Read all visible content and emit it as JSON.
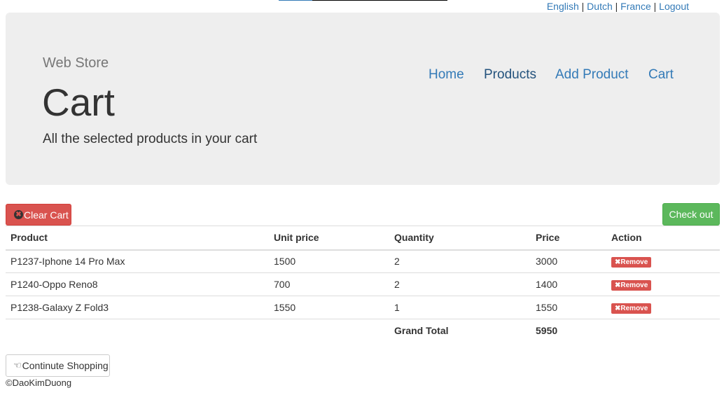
{
  "loading_bar": {
    "progress": 0.2
  },
  "language_bar": {
    "items": [
      "English",
      "Dutch",
      "France",
      "Logout"
    ],
    "separator": "|"
  },
  "header": {
    "brand": "Web Store",
    "title": "Cart",
    "subtitle": "All the selected products in your cart"
  },
  "nav": {
    "items": [
      {
        "label": "Home",
        "active": false
      },
      {
        "label": "Products",
        "active": true
      },
      {
        "label": "Add Product",
        "active": false
      },
      {
        "label": "Cart",
        "active": false
      }
    ]
  },
  "actions": {
    "clear_cart": "Clear Cart",
    "checkout": "Check out",
    "continue_shopping": "Continute Shopping"
  },
  "table": {
    "headers": [
      "Product",
      "Unit price",
      "Quantity",
      "Price",
      "Action"
    ],
    "rows": [
      {
        "product": "P1237-Iphone 14 Pro Max",
        "unit_price": "1500",
        "quantity": "2",
        "price": "3000",
        "action": "Remove"
      },
      {
        "product": "P1240-Oppo Reno8",
        "unit_price": "700",
        "quantity": "2",
        "price": "1400",
        "action": "Remove"
      },
      {
        "product": "P1238-Galaxy Z Fold3",
        "unit_price": "1550",
        "quantity": "1",
        "price": "1550",
        "action": "Remove"
      }
    ],
    "grand_total_label": "Grand Total",
    "grand_total_value": "5950"
  },
  "icons": {
    "clear_cart": "times-circle-icon",
    "remove": "times-icon",
    "continue": "hand-pointer-icon"
  },
  "colors": {
    "link": "#337ab7",
    "danger": "#d9534f",
    "success": "#5cb85c",
    "jumbotron": "#eeeeee"
  },
  "footer": {
    "text": "©DaoKimDuong"
  }
}
